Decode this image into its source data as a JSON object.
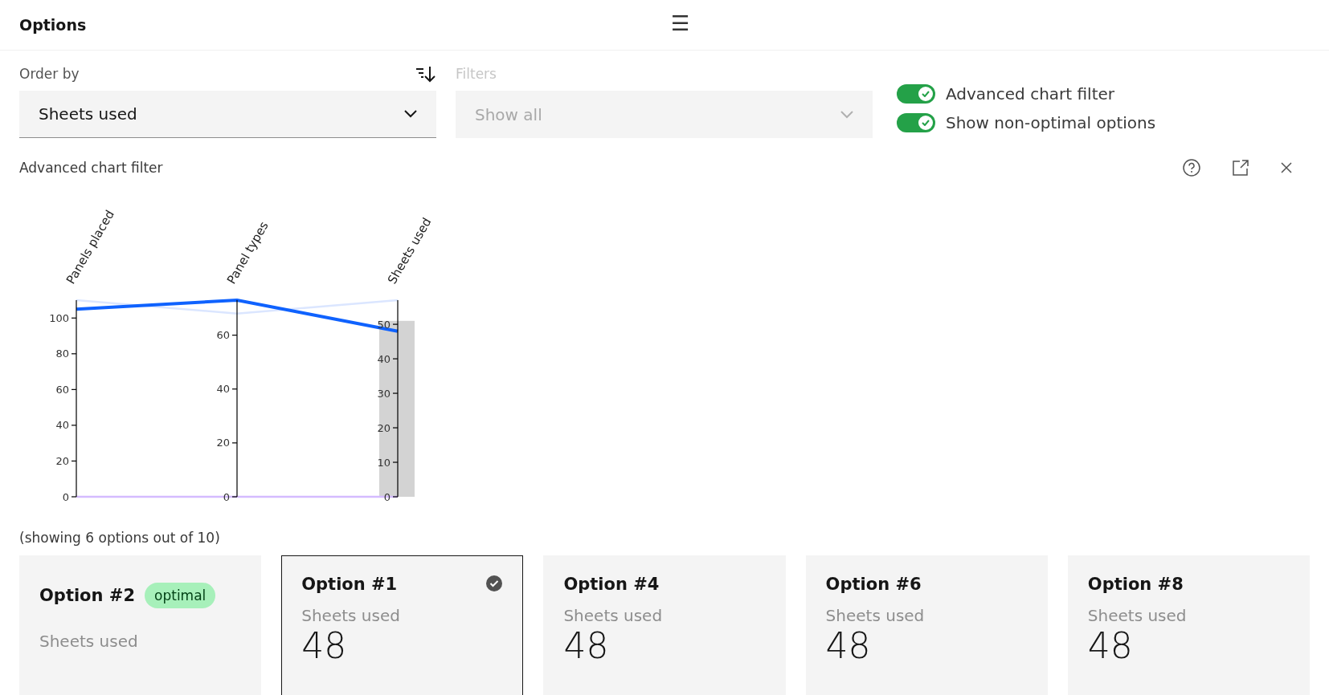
{
  "header": {
    "title": "Options",
    "menu_icon": "☰"
  },
  "order_by": {
    "label": "Order by",
    "value": "Sheets used"
  },
  "filters": {
    "label": "Filters",
    "value": "Show all",
    "disabled": true
  },
  "toggles": [
    {
      "label": "Advanced chart filter",
      "on": true
    },
    {
      "label": "Show non-optimal options",
      "on": true
    }
  ],
  "advanced_chart": {
    "title": "Advanced chart filter",
    "axes": [
      {
        "title": "Panels placed",
        "ticks": [
          "100",
          "80",
          "60",
          "40",
          "20",
          "0"
        ]
      },
      {
        "title": "Panel types",
        "ticks": [
          "60",
          "40",
          "20",
          "0"
        ]
      },
      {
        "title": "Sheets used",
        "ticks": [
          "50",
          "40",
          "30",
          "20",
          "10",
          "0"
        ]
      }
    ]
  },
  "summary": "(showing 6 options out of 10)",
  "cards": [
    {
      "title": "Option #2",
      "optimal": true,
      "badge": "optimal",
      "selected": false,
      "metric": "Sheets used"
    },
    {
      "title": "Option #1",
      "optimal": false,
      "selected": true,
      "metric": "Sheets used",
      "value": "48"
    },
    {
      "title": "Option #4",
      "optimal": false,
      "selected": false,
      "metric": "Sheets used",
      "value": "48"
    },
    {
      "title": "Option #6",
      "optimal": false,
      "selected": false,
      "metric": "Sheets used",
      "value": "48"
    },
    {
      "title": "Option #8",
      "optimal": false,
      "selected": false,
      "metric": "Sheets used",
      "value": "48"
    }
  ]
}
